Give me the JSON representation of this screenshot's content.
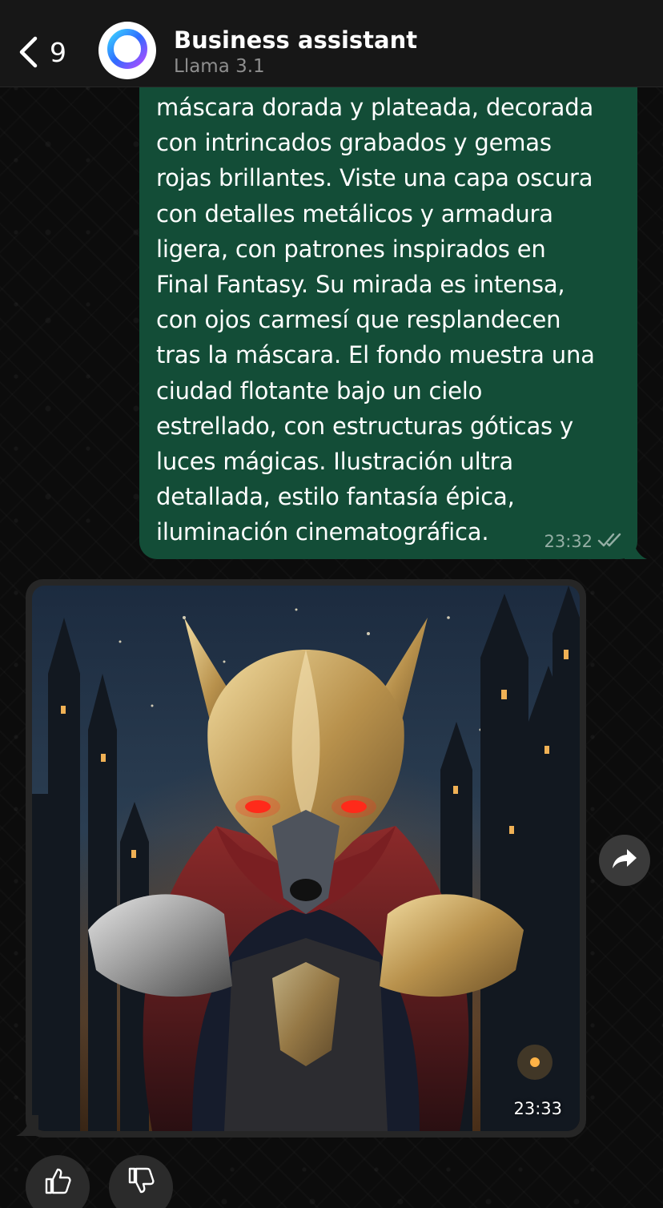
{
  "header": {
    "back_count": "9",
    "title": "Business assistant",
    "subtitle": "Llama 3.1"
  },
  "outgoing_message": {
    "lines": [
      "máscara dorada y plateada, decorada",
      "con intrincados grabados y gemas",
      "rojas brillantes. Viste una capa oscura",
      "con detalles metálicos y armadura",
      "ligera, con patrones inspirados en",
      "Final Fantasy. Su mirada es intensa,",
      "con ojos carmesí que resplandecen",
      "tras la máscara. El fondo muestra una",
      "ciudad flotante bajo un cielo",
      "estrellado, con estructuras góticas y",
      "luces mágicas. Ilustración ultra",
      "detallada, estilo fantasía épica,",
      "iluminación cinematográfica."
    ],
    "time": "23:32",
    "status_icon": "double-check-read-icon"
  },
  "incoming_image": {
    "time": "23:33"
  },
  "colors": {
    "header_bg": "#171717",
    "outgoing_bubble": "#134d37",
    "incoming_bubble": "#262626",
    "background": "#0c0c0c"
  },
  "icons": {
    "back": "chevron-left-icon",
    "avatar": "meta-ai-ring-icon",
    "share": "forward-arrow-icon",
    "like": "thumbs-up-icon",
    "dislike": "thumbs-down-icon"
  }
}
